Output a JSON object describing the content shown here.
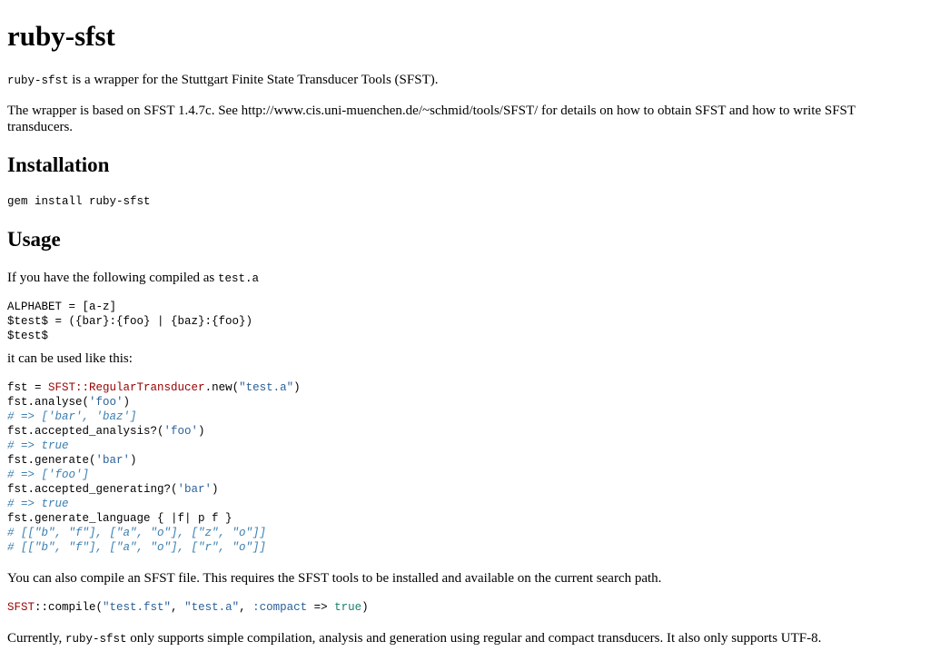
{
  "title": "ruby-sfst",
  "intro": {
    "code_name": "ruby-sfst",
    "text": " is a wrapper for the Stuttgart Finite State Transducer Tools (SFST)."
  },
  "based_on": "The wrapper is based on SFST 1.4.7c. See http://www.cis.uni-muenchen.de/~schmid/tools/SFST/ for details on how to obtain SFST and how to write SFST transducers.",
  "installation": {
    "heading": "Installation",
    "command": "gem install ruby-sfst"
  },
  "usage": {
    "heading": "Usage",
    "compiled_intro": "If you have the following compiled as ",
    "compiled_file": "test.a",
    "source_lines": [
      "ALPHABET = [a-z]",
      "$test$ = ({bar}:{foo} | {baz}:{foo})",
      "$test$"
    ],
    "used_like": "it can be used like this:",
    "example": {
      "l1_a": "fst = ",
      "l1_const": "SFST::",
      "l1_class": "RegularTransducer",
      "l1_b": ".new(",
      "l1_str": "\"test.a\"",
      "l1_c": ")",
      "l2_a": "fst.analyse(",
      "l2_str": "'foo'",
      "l2_b": ")",
      "l3": "# => ['bar', 'baz']",
      "l4_a": "fst.accepted_analysis?(",
      "l4_str": "'foo'",
      "l4_b": ")",
      "l5": "# => true",
      "l6_a": "fst.generate(",
      "l6_str": "'bar'",
      "l6_b": ")",
      "l7": "# => ['foo']",
      "l8_a": "fst.accepted_generating?(",
      "l8_str": "'bar'",
      "l8_b": ")",
      "l9": "# => true",
      "l10": "fst.generate_language { |f| p f }",
      "l11": "# [[\"b\", \"f\"], [\"a\", \"o\"], [\"z\", \"o\"]]",
      "l12": "# [[\"b\", \"f\"], [\"a\", \"o\"], [\"r\", \"o\"]]"
    },
    "compile_text": "You can also compile an SFST file. This requires the SFST tools to be installed and available on the current search path.",
    "compile_code": {
      "const": "SFST",
      "a": "::compile(",
      "s1": "\"test.fst\"",
      "b": ", ",
      "s2": "\"test.a\"",
      "c": ", ",
      "sym": ":compact",
      "d": " => ",
      "kw": "true",
      "e": ")"
    },
    "closing_a": "Currently, ",
    "closing_code": "ruby-sfst",
    "closing_b": " only supports simple compilation, analysis and generation using regular and compact transducers. It also only supports UTF-8."
  }
}
